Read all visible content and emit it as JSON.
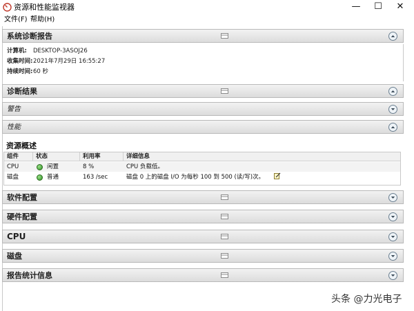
{
  "window": {
    "title": "资源和性能监视器",
    "minimize": "—",
    "maximize": "☐",
    "close": "✕"
  },
  "menu": {
    "file": "文件(F)",
    "help": "帮助(H)"
  },
  "system_report": {
    "header": "系统诊断报告",
    "computer_label": "计算机:",
    "computer_value": "DESKTOP-3ASOJ26",
    "collected_label": "收集时间:",
    "collected_value": "2021年7月29日  16:55:27",
    "duration_label": "持续时间:",
    "duration_value": "60 秒"
  },
  "diagnosis": {
    "header": "诊断结果",
    "warnings": "警告",
    "performance": "性能"
  },
  "resource_overview": {
    "title": "资源概述",
    "columns": [
      "组件",
      "状态",
      "利用率",
      "详细信息"
    ],
    "rows": [
      {
        "component": "CPU",
        "status": "闲置",
        "usage": "8 %",
        "details": "CPU 负载低。"
      },
      {
        "component": "磁盘",
        "status": "普通",
        "usage": "163 /sec",
        "details": "磁盘 0 上的磁盘 I/O 为每秒 100 到 500 (读/写)次。"
      }
    ]
  },
  "sections": {
    "software": "软件配置",
    "hardware": "硬件配置",
    "cpu": "CPU",
    "disk": "磁盘",
    "stats": "报告统计信息"
  },
  "watermark": "头条 @力光电子",
  "colors": {
    "header_bg": "#e4e4e4",
    "status_ok": "#2e8b23",
    "toggle": "#5a6b7a"
  }
}
